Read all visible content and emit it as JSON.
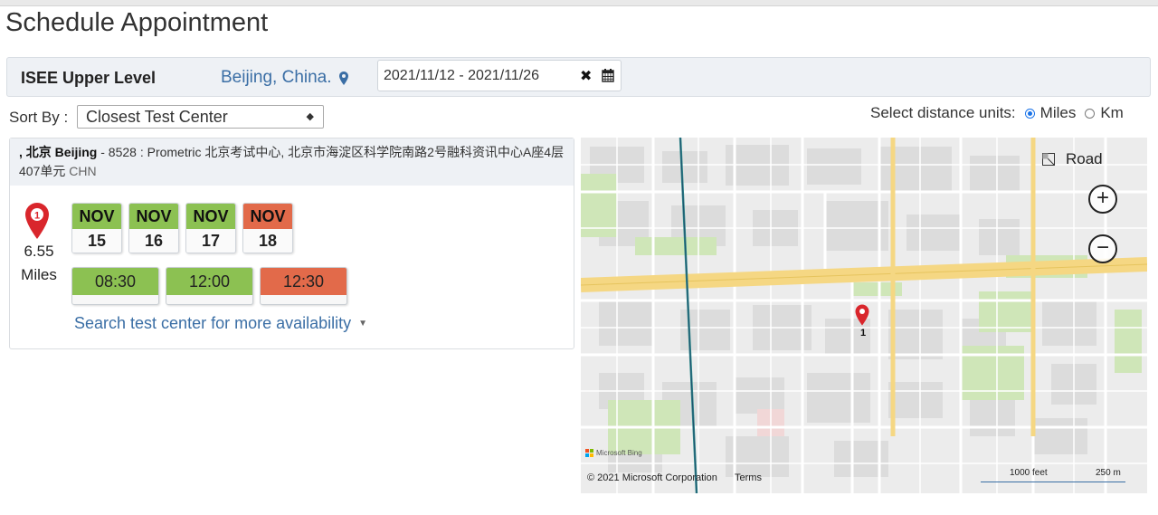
{
  "page": {
    "title": "Schedule Appointment"
  },
  "header": {
    "exam_name": "ISEE Upper Level",
    "location": "Beijing, China.",
    "date_range": "2021/11/12 - 2021/11/26",
    "clear_glyph": "✖"
  },
  "sort": {
    "label": "Sort By :",
    "selected": "Closest Test Center"
  },
  "units": {
    "label": "Select distance units:",
    "options": [
      "Miles",
      "Km"
    ],
    "selected": "Miles"
  },
  "result": {
    "city": ", 北京 Beijing",
    "details": "- 8528 : Prometric 北京考试中心, 北京市海淀区科学院南路2号融科资讯中心A座4层407单元",
    "country": "CHN",
    "marker_number": "1",
    "distance_value": "6.55",
    "distance_unit": "Miles",
    "dates": [
      {
        "month": "NOV",
        "day": "15",
        "status": "available"
      },
      {
        "month": "NOV",
        "day": "16",
        "status": "available"
      },
      {
        "month": "NOV",
        "day": "17",
        "status": "available"
      },
      {
        "month": "NOV",
        "day": "18",
        "status": "selected"
      }
    ],
    "times": [
      {
        "time": "08:30",
        "status": "available"
      },
      {
        "time": "12:00",
        "status": "available"
      },
      {
        "time": "12:30",
        "status": "selected"
      }
    ],
    "more_link": "Search test center for more availability"
  },
  "map": {
    "road_label": "Road",
    "zoom_in": "+",
    "zoom_out": "−",
    "pin_label": "1",
    "logo_text": "Microsoft Bing",
    "copyright": "© 2021 Microsoft Corporation",
    "terms": "Terms",
    "scale_feet": "1000 feet",
    "scale_m": "250 m"
  },
  "colors": {
    "available": "#8cc152",
    "selected": "#e26a4a",
    "link": "#3a6ea5",
    "pin": "#d9262c"
  },
  "icons": [
    "map-marker-icon",
    "clear-icon",
    "calendar-icon",
    "caret-down-icon",
    "road-icon",
    "zoom-in-icon",
    "zoom-out-icon",
    "location-pin-icon"
  ]
}
